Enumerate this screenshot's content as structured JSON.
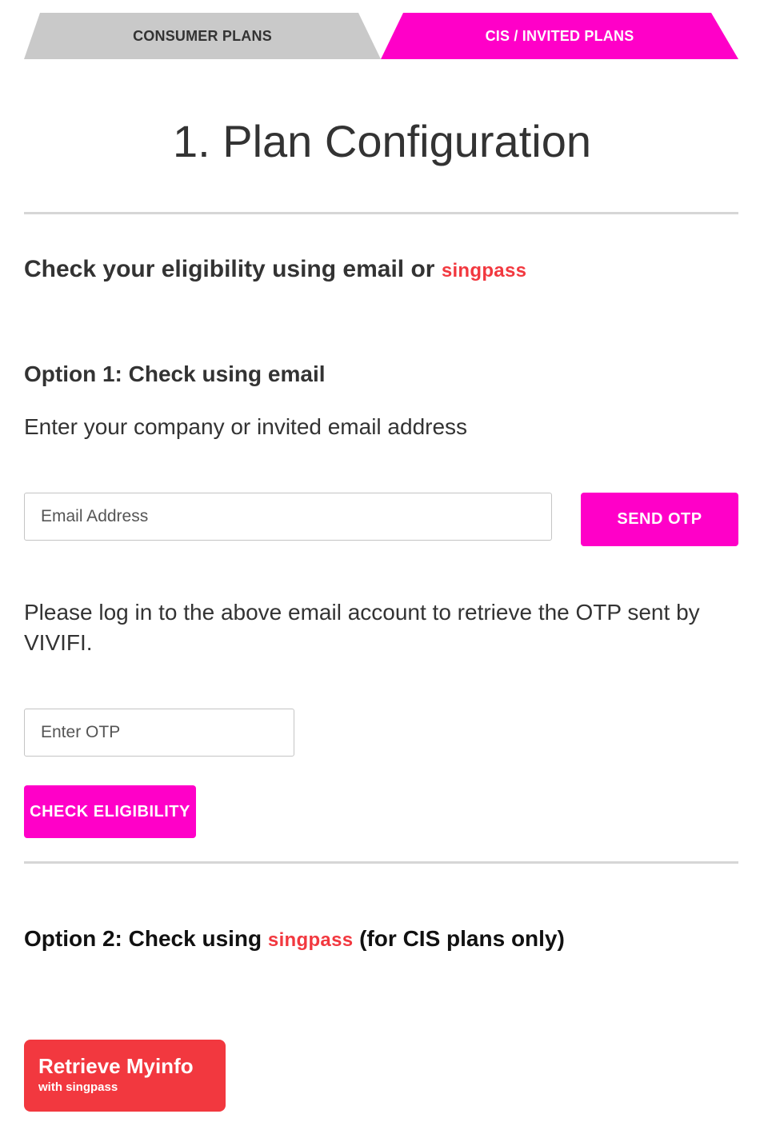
{
  "tabs": {
    "consumer": "CONSUMER PLANS",
    "cis": "CIS / INVITED PLANS",
    "active": "cis"
  },
  "title": "1. Plan Configuration",
  "eligibility_heading": {
    "text": "Check your eligibility using email or",
    "singpass_logo": "singpass"
  },
  "option1": {
    "title": "Option 1: Check using email",
    "instruction": "Enter your company or invited email address",
    "email_placeholder": "Email Address",
    "send_otp_label": "SEND OTP",
    "otp_note": "Please log in to the above email account to retrieve the OTP sent by VIVIFI.",
    "otp_placeholder": "Enter OTP",
    "check_label": "CHECK ELIGIBILITY"
  },
  "option2": {
    "title_prefix": "Option 2: Check using",
    "singpass_logo": "singpass",
    "title_suffix": "(for CIS plans only)",
    "myinfo_main": "Retrieve Myinfo",
    "myinfo_sub": "with singpass"
  },
  "colors": {
    "accent": "#ff00c8",
    "singpass_red": "#f2383f",
    "tab_inactive": "#c9c9c9",
    "text": "#333333"
  }
}
